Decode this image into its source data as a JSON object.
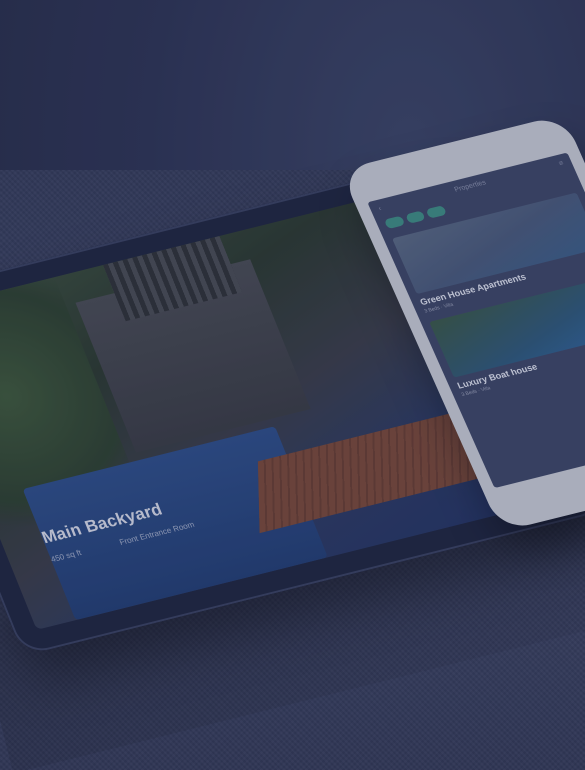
{
  "tablet": {
    "title": "Main Backyard",
    "meta_left": "450 sq ft",
    "meta_right": "Front Entrance Room"
  },
  "phone": {
    "header_title": "Properties",
    "chips": [
      "",
      "",
      ""
    ],
    "cards": [
      {
        "title": "Green House Apartments",
        "meta": "3 Beds · Villa"
      },
      {
        "title": "Luxury Boat house",
        "meta": "3 Beds · Villa"
      }
    ]
  }
}
